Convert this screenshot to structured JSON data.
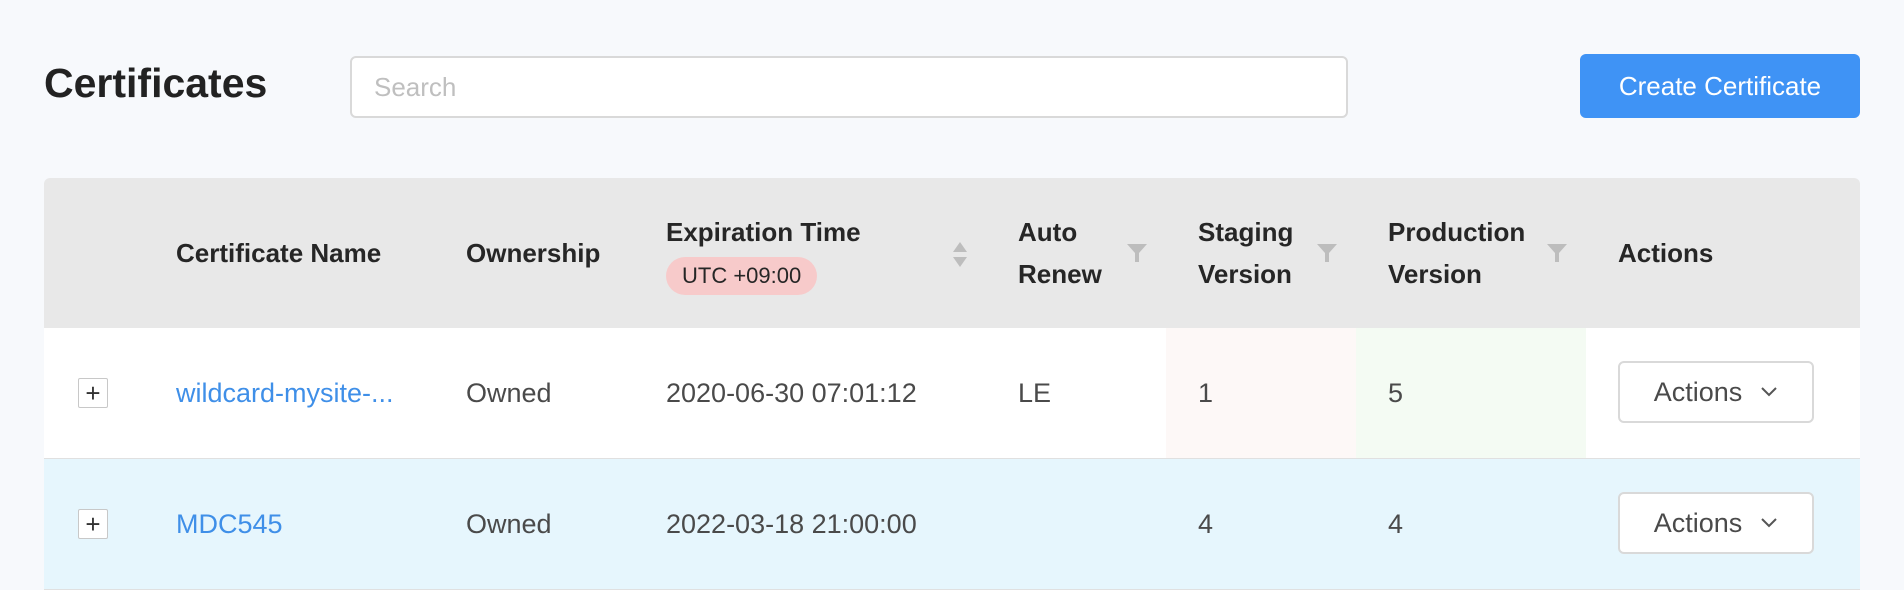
{
  "header": {
    "title": "Certificates",
    "search_placeholder": "Search",
    "create_label": "Create Certificate"
  },
  "table": {
    "columns": {
      "name": "Certificate Name",
      "ownership": "Ownership",
      "expiration": "Expiration Time",
      "utc_badge": "UTC +09:00",
      "auto_renew_1": "Auto",
      "auto_renew_2": "Renew",
      "staging_1": "Staging",
      "staging_2": "Version",
      "production_1": "Production",
      "production_2": "Version",
      "actions": "Actions"
    },
    "rows": [
      {
        "expand": "+",
        "name": "wildcard-mysite-...",
        "ownership": "Owned",
        "expiration": "2020-06-30 07:01:12",
        "auto_renew": "LE",
        "staging": "1",
        "production": "5",
        "actions_label": "Actions"
      },
      {
        "expand": "+",
        "name": "MDC545",
        "ownership": "Owned",
        "expiration": "2022-03-18 21:00:00",
        "auto_renew": "",
        "staging": "4",
        "production": "4",
        "actions_label": "Actions"
      }
    ]
  },
  "colors": {
    "accent": "#3f93f5",
    "link": "#3f8fe8",
    "utc_badge_bg": "#f7caca",
    "selected_row_bg": "#e6f6fd",
    "staging_cell_bg": "#fdf8f7",
    "production_cell_bg": "#f4fbf3"
  },
  "icons": {
    "filter": "filter-icon",
    "sort": "sort-icon",
    "expand": "plus-icon",
    "dropdown": "chevron-down-icon"
  }
}
